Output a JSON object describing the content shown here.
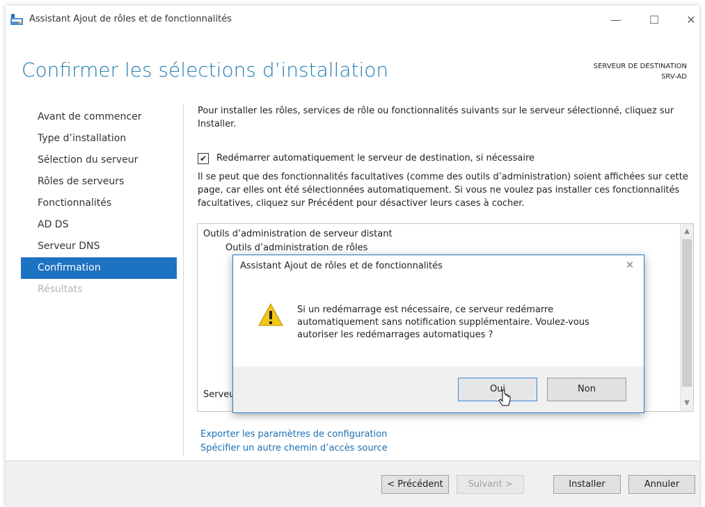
{
  "window": {
    "title": "Assistant Ajout de rôles et de fonctionnalités",
    "controls": {
      "minimize": "—",
      "maximize": "☐",
      "close": "✕"
    }
  },
  "page": {
    "heading": "Confirmer les sélections d’installation",
    "destination_label": "SERVEUR DE DESTINATION",
    "destination_server": "SRV-AD"
  },
  "nav": {
    "items": [
      {
        "label": "Avant de commencer",
        "state": "normal"
      },
      {
        "label": "Type d’installation",
        "state": "normal"
      },
      {
        "label": "Sélection du serveur",
        "state": "normal"
      },
      {
        "label": "Rôles de serveurs",
        "state": "normal"
      },
      {
        "label": "Fonctionnalités",
        "state": "normal"
      },
      {
        "label": "AD DS",
        "state": "normal"
      },
      {
        "label": "Serveur DNS",
        "state": "normal"
      },
      {
        "label": "Confirmation",
        "state": "active"
      },
      {
        "label": "Résultats",
        "state": "disabled"
      }
    ]
  },
  "content": {
    "intro": "Pour installer les rôles, services de rôle ou fonctionnalités suivants sur le serveur sélectionné, cliquez sur Installer.",
    "restart_checkbox": {
      "label": "Redémarrer automatiquement le serveur de destination, si nécessaire",
      "checked": true,
      "mark": "✔"
    },
    "note": "Il se peut que des fonctionnalités facultatives (comme des outils d’administration) soient affichées sur cette page, car elles ont été sélectionnées automatiquement. Si vous ne voulez pas installer ces fonctionnalités facultatives, cliquez sur Précédent pour désactiver leurs cases à cocher.",
    "list": {
      "item1": "Outils d’administration de serveur distant",
      "item2": "Outils d’administration de rôles",
      "item3": "Serveu"
    },
    "links": {
      "export": "Exporter les paramètres de configuration",
      "source": "Spécifier un autre chemin d’accès source"
    }
  },
  "footer": {
    "previous": "< Précédent",
    "next": "Suivant >",
    "install": "Installer",
    "cancel": "Annuler"
  },
  "dialog": {
    "title": "Assistant Ajout de rôles et de fonctionnalités",
    "close": "✕",
    "message": "Si un redémarrage est nécessaire, ce serveur redémarre automatiquement sans notification supplémentaire. Voulez-vous autoriser les redémarrages automatiques ?",
    "yes": "Oui",
    "no": "Non",
    "icon": "warning-icon"
  },
  "colors": {
    "accent": "#1e72c2",
    "heading": "#1f7ab0",
    "link": "#1a6fb5",
    "warning": "#f5c518"
  }
}
